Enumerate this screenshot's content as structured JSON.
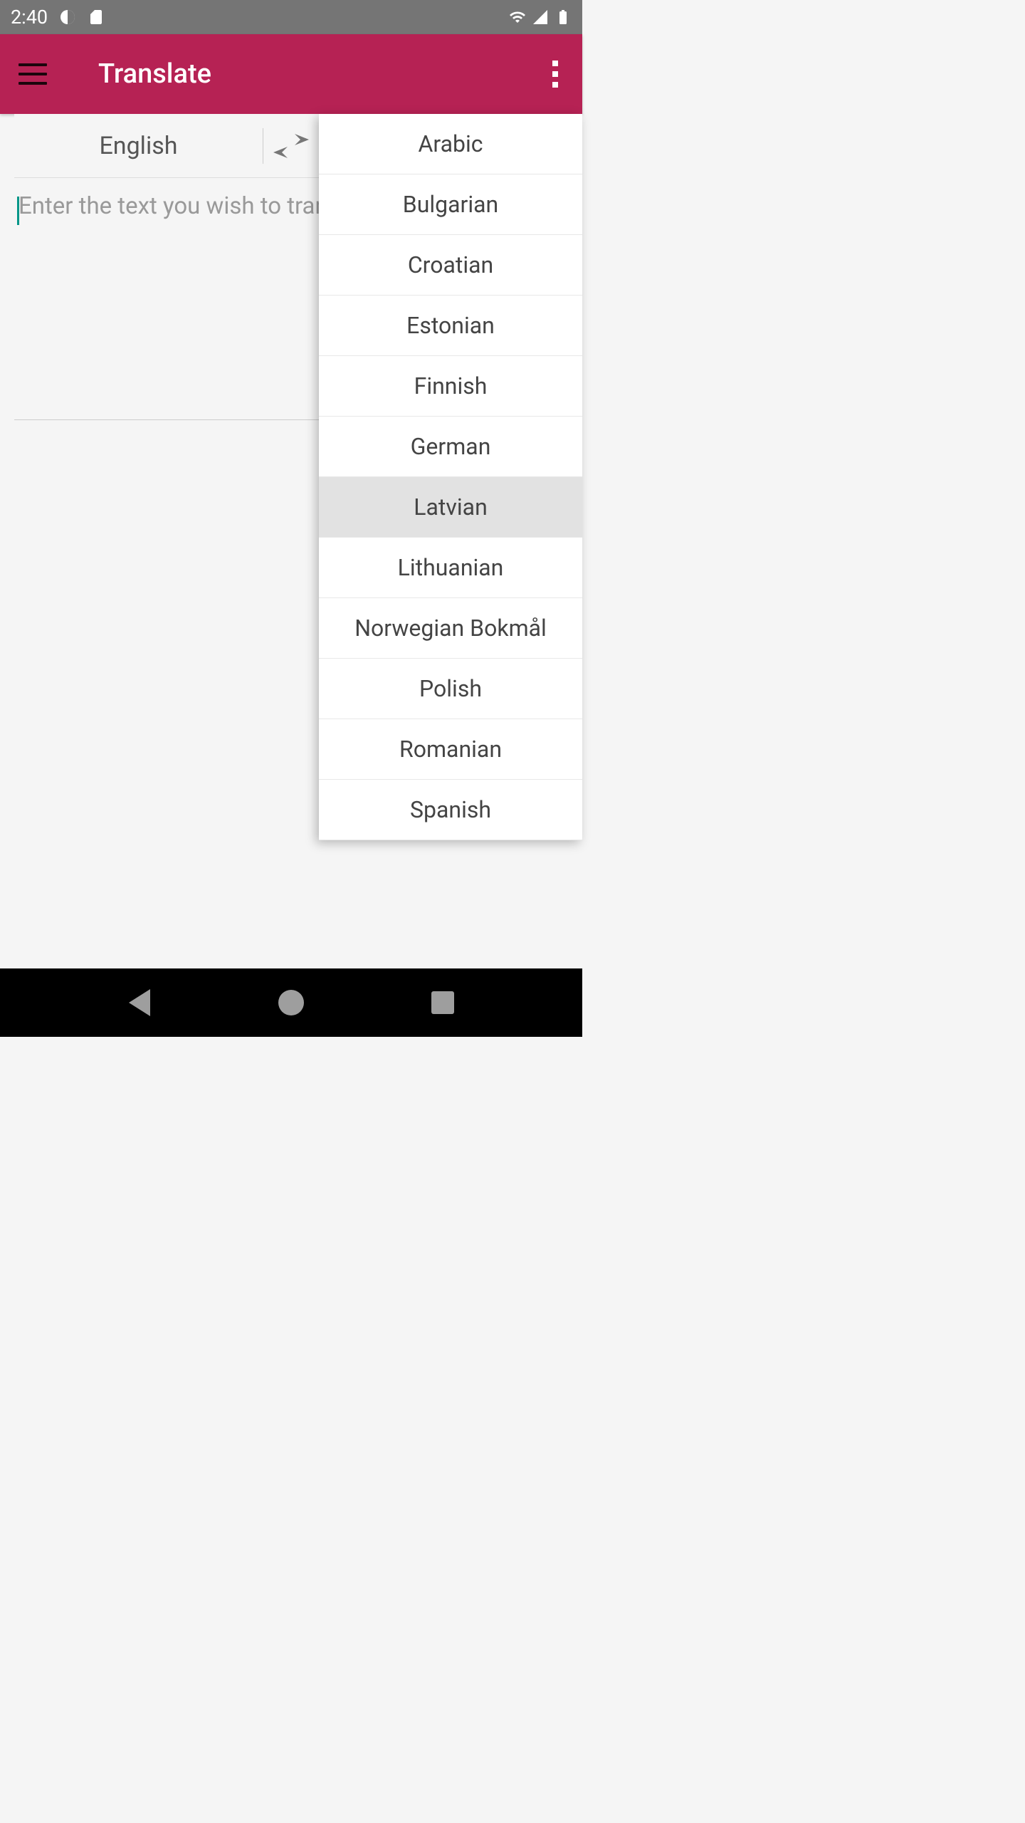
{
  "status": {
    "time": "2:40"
  },
  "header": {
    "title": "Translate"
  },
  "source_lang": "English",
  "target_lang": "Latvian",
  "input_placeholder": "Enter the text you wish to translate",
  "dropdown": {
    "items": [
      {
        "label": "Arabic",
        "highlighted": false
      },
      {
        "label": "Bulgarian",
        "highlighted": false
      },
      {
        "label": "Croatian",
        "highlighted": false
      },
      {
        "label": "Estonian",
        "highlighted": false
      },
      {
        "label": "Finnish",
        "highlighted": false
      },
      {
        "label": "German",
        "highlighted": false
      },
      {
        "label": "Latvian",
        "highlighted": true
      },
      {
        "label": "Lithuanian",
        "highlighted": false
      },
      {
        "label": "Norwegian Bokmål",
        "highlighted": false
      },
      {
        "label": "Polish",
        "highlighted": false
      },
      {
        "label": "Romanian",
        "highlighted": false
      },
      {
        "label": "Spanish",
        "highlighted": false
      }
    ]
  }
}
